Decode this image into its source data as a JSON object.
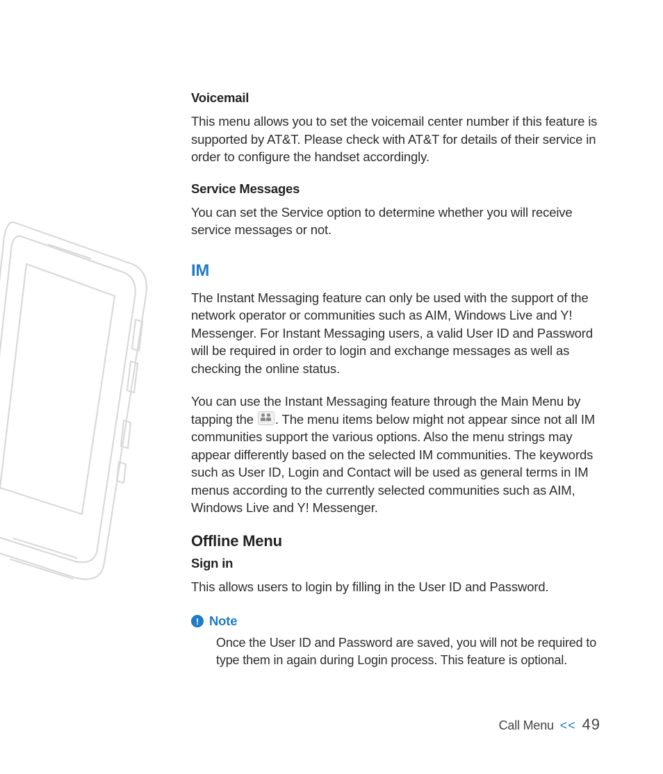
{
  "sections": {
    "voicemail": {
      "title": "Voicemail",
      "body": "This menu allows you to set the voicemail center number if this feature is supported by AT&T. Please check with AT&T for details of their service in order to configure the handset accordingly."
    },
    "service_messages": {
      "title": "Service Messages",
      "body": "You can set the Service option to determine whether you will receive service messages or not."
    },
    "im": {
      "title": "IM",
      "para1": "The Instant Messaging feature can only be used with the support of the network operator or communities such as AIM, Windows Live and Y! Messenger. For Instant Messaging users, a valid User ID and Password will be required in order to login and exchange messages as well as checking the online status.",
      "para2a": "You can use the Instant Messaging feature through the Main Menu by tapping the ",
      "para2b": ". The menu items below might not appear since not all IM communities support the various options. Also the menu strings may appear differently based on the selected IM communities. The keywords such as User ID, Login and Contact will be used as general terms in IM menus according to the currently selected communities such as AIM, Windows Live and Y! Messenger."
    },
    "offline_menu": {
      "title": "Offline Menu",
      "signin_title": "Sign in",
      "signin_body": "This allows users to login by filling in the User ID and Password."
    },
    "note": {
      "label": "Note",
      "icon_glyph": "!",
      "body": "Once the User ID and Password are saved, you will not be required to type them in again during Login process. This feature is optional."
    }
  },
  "footer": {
    "section": "Call Menu",
    "separator": "<<",
    "page": "49"
  },
  "icons": {
    "im_icon": "contacts-icon"
  }
}
